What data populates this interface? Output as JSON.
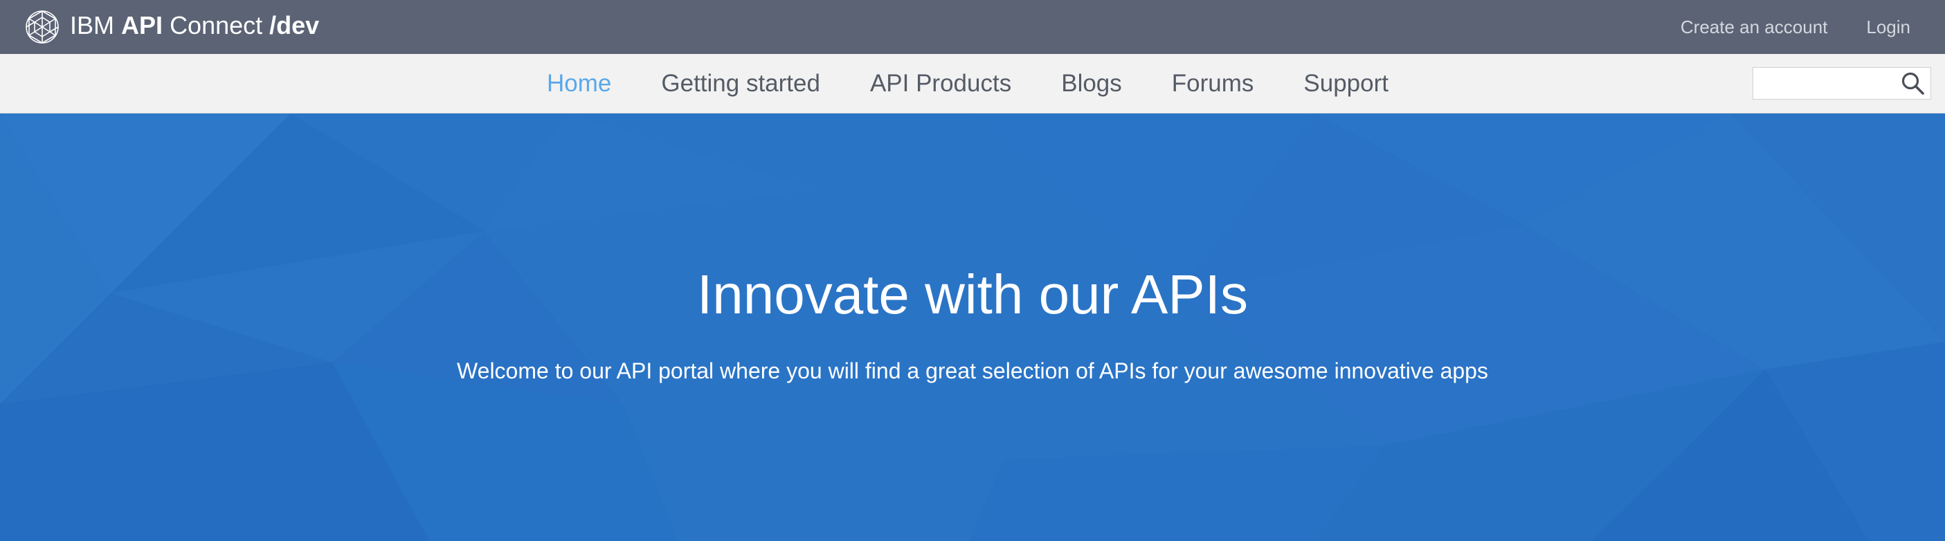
{
  "header": {
    "brand": {
      "ibm": "IBM",
      "api": "API",
      "connect": "Connect",
      "dev": "/dev"
    },
    "account_links": {
      "create_account": "Create an account",
      "login": "Login"
    }
  },
  "nav": {
    "items": [
      {
        "label": "Home",
        "active": true
      },
      {
        "label": "Getting started",
        "active": false
      },
      {
        "label": "API Products",
        "active": false
      },
      {
        "label": "Blogs",
        "active": false
      },
      {
        "label": "Forums",
        "active": false
      },
      {
        "label": "Support",
        "active": false
      }
    ],
    "search": {
      "value": "",
      "placeholder": "",
      "icon": "search-icon"
    }
  },
  "hero": {
    "title": "Innovate with our APIs",
    "subtitle": "Welcome to our API portal where you will find a great selection of APIs for your awesome innovative apps"
  },
  "colors": {
    "topbar": "#5b6375",
    "navbar": "#f2f2f2",
    "nav_active": "#5aa7ea",
    "nav_text": "#555b66",
    "hero": "#2a73c5"
  }
}
